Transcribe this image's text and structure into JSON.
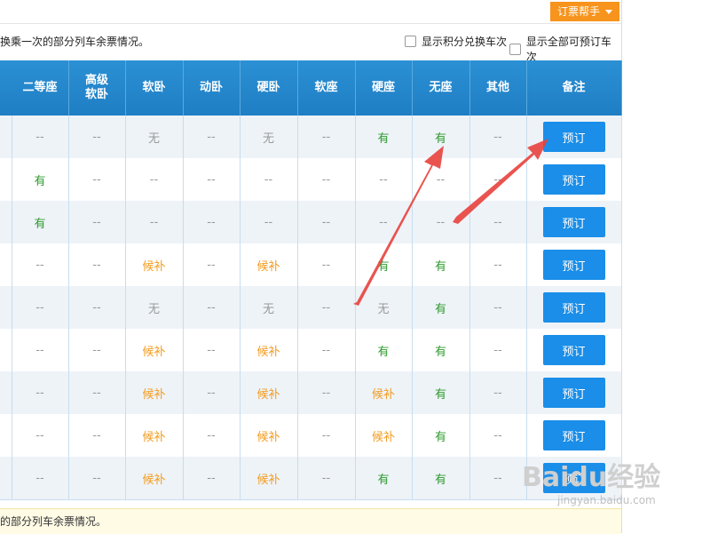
{
  "top": {
    "help_label": "订票帮手"
  },
  "filters": {
    "note": "换乘一次的部分列车余票情况。",
    "option_points": "显示积分兑换车次",
    "option_all": "显示全部可预订车次"
  },
  "table": {
    "headers": [
      "二等座",
      "高级\n软卧",
      "软卧",
      "动卧",
      "硬卧",
      "软座",
      "硬座",
      "无座",
      "其他",
      "备注"
    ],
    "book_label": "预订",
    "rows": [
      [
        "--",
        "--",
        "无",
        "--",
        "无",
        "--",
        "有",
        "有",
        "--"
      ],
      [
        "有",
        "--",
        "--",
        "--",
        "--",
        "--",
        "--",
        "--",
        "--"
      ],
      [
        "有",
        "--",
        "--",
        "--",
        "--",
        "--",
        "--",
        "--",
        "--"
      ],
      [
        "--",
        "--",
        "候补",
        "--",
        "候补",
        "--",
        "有",
        "有",
        "--"
      ],
      [
        "--",
        "--",
        "无",
        "--",
        "无",
        "--",
        "无",
        "有",
        "--"
      ],
      [
        "--",
        "--",
        "候补",
        "--",
        "候补",
        "--",
        "有",
        "有",
        "--"
      ],
      [
        "--",
        "--",
        "候补",
        "--",
        "候补",
        "--",
        "候补",
        "有",
        "--"
      ],
      [
        "--",
        "--",
        "候补",
        "--",
        "候补",
        "--",
        "候补",
        "有",
        "--"
      ],
      [
        "--",
        "--",
        "候补",
        "--",
        "候补",
        "--",
        "有",
        "有",
        "--"
      ]
    ]
  },
  "footer": {
    "note": "的部分列车余票情况。"
  },
  "watermark": {
    "brand": "Baidu经验",
    "url": "jingyan.baidu.com"
  },
  "colors": {
    "header_blue": "#2b90d4",
    "button_blue": "#1a8ee8",
    "orange": "#f7941d",
    "green": "#2e9a2e",
    "arrow_red": "#e8413c"
  }
}
